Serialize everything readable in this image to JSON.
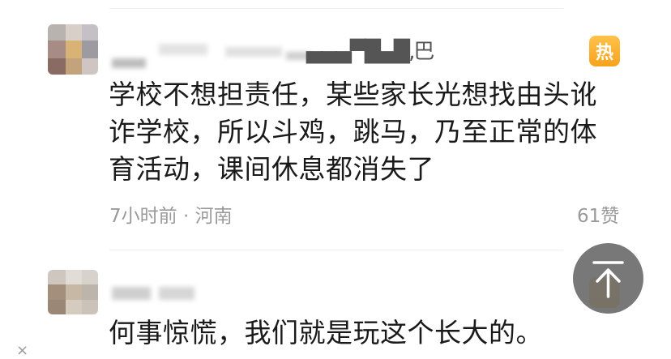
{
  "comments": [
    {
      "username_fragment": "▄▄▄▀█▄█‚巴",
      "hot_badge": "热",
      "text": "学校不想担责任，某些家长光想找由头讹诈学校，所以斗鸡，跳马，乃至正常的体育活动，课间休息都消失了",
      "time_location": "7小时前 · 河南",
      "likes": "61赞"
    },
    {
      "text": "何事惊慌，我们就是玩这个长大的。"
    }
  ],
  "controls": {
    "close_glyph": "×"
  },
  "colors": {
    "hot_badge": "#f7a21c",
    "meta_text": "#9a9a9a",
    "body_text": "#1a1a1a",
    "back_top_bg": "#5a5a5a"
  },
  "icons": {
    "back_to_top": "arrow-up-to-line-icon",
    "hot": "hot-badge-icon",
    "close": "close-icon"
  }
}
